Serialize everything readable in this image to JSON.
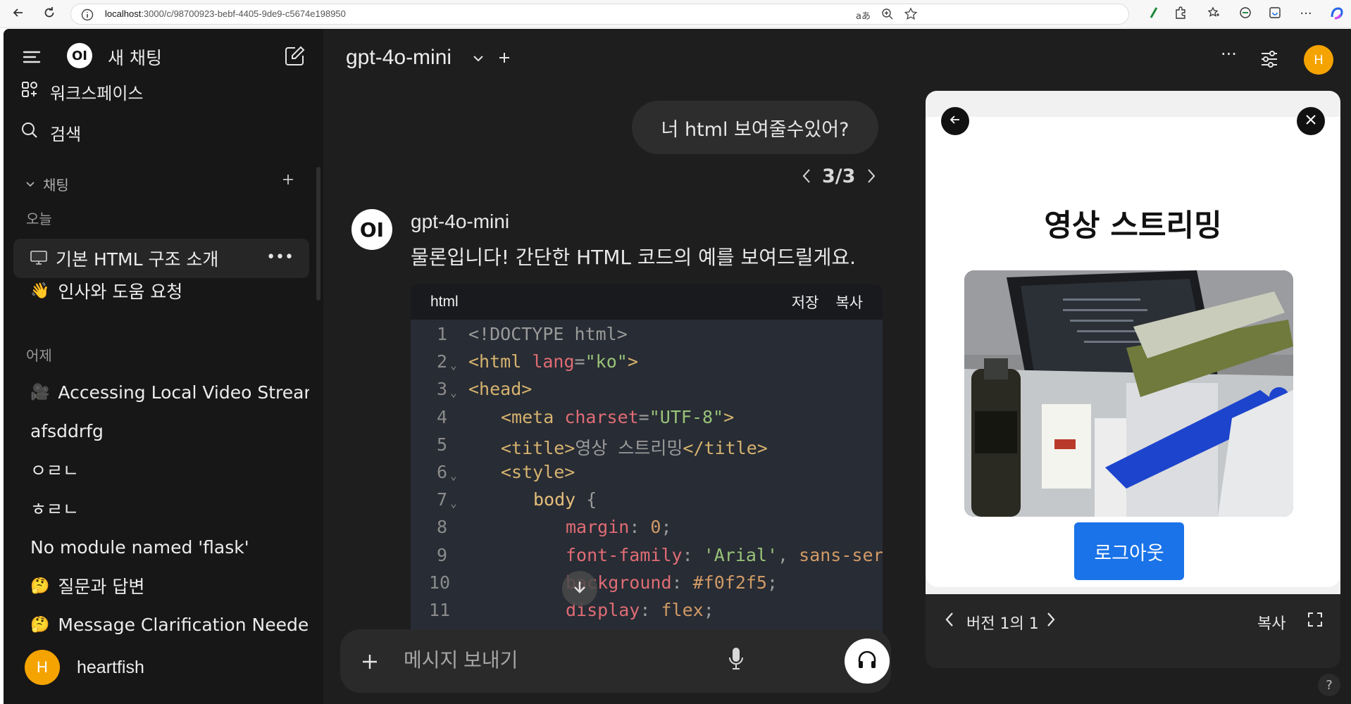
{
  "browser": {
    "url_host": "localhost",
    "url_path": ":3000/c/98700923-bebf-4405-9de9-c5674e198950",
    "icons": [
      "back-icon",
      "reload-icon",
      "info-icon",
      "translate-icon",
      "zoom-icon",
      "favorite-icon",
      "extension-icon",
      "puzzle-icon",
      "collections-icon",
      "shield-icon",
      "browser-essentials-icon",
      "more-icon",
      "copilot-icon"
    ]
  },
  "sidebar": {
    "new_chat": "새 채팅",
    "workspace": "워크스페이스",
    "search": "검색",
    "chats_section": "채팅",
    "today": "오늘",
    "yesterday": "어제",
    "today_items": [
      {
        "emoji": "💻",
        "label": "기본 HTML 구조 소개"
      },
      {
        "emoji": "👋",
        "label": "인사와 도움 요청"
      }
    ],
    "yesterday_items": [
      {
        "emoji": "🎥",
        "label": "Accessing Local Video Strear"
      },
      {
        "emoji": "",
        "label": "afsddrfg"
      },
      {
        "emoji": "",
        "label": "ㅇㄹㄴ"
      },
      {
        "emoji": "",
        "label": "ㅎㄹㄴ"
      },
      {
        "emoji": "",
        "label": "No module named 'flask'"
      },
      {
        "emoji": "🤔",
        "label": "질문과 답변"
      },
      {
        "emoji": "🤔",
        "label": "Message Clarification Neede"
      }
    ],
    "user_initial": "H",
    "user_name": "heartfish"
  },
  "header": {
    "model": "gpt-4o-mini",
    "user_initial": "H"
  },
  "chat": {
    "user_message": "너 html 보여줄수있어?",
    "pager": "3/3",
    "bot_logo": "OI",
    "bot_name": "gpt-4o-mini",
    "bot_text": "물론입니다! 간단한 HTML 코드의 예를 보여드릴게요.",
    "code_lang": "html",
    "code_save": "저장",
    "code_copy": "복사"
  },
  "code_lines": [
    {
      "n": "1",
      "fold": "",
      "indent": 0,
      "parts": [
        {
          "t": "<!DOCTYPE html>",
          "c": "muted"
        }
      ]
    },
    {
      "n": "2",
      "fold": "⌄",
      "indent": 0,
      "parts": [
        {
          "t": "<html ",
          "c": "tag"
        },
        {
          "t": "lang",
          "c": "attr"
        },
        {
          "t": "=",
          "c": "muted"
        },
        {
          "t": "\"ko\"",
          "c": "str"
        },
        {
          "t": ">",
          "c": "tag"
        }
      ]
    },
    {
      "n": "3",
      "fold": "⌄",
      "indent": 0,
      "parts": [
        {
          "t": "<head>",
          "c": "tag"
        }
      ]
    },
    {
      "n": "4",
      "fold": "",
      "indent": 1,
      "parts": [
        {
          "t": "<meta ",
          "c": "tag"
        },
        {
          "t": "charset",
          "c": "attr"
        },
        {
          "t": "=",
          "c": "muted"
        },
        {
          "t": "\"UTF-8\"",
          "c": "str"
        },
        {
          "t": ">",
          "c": "tag"
        }
      ]
    },
    {
      "n": "5",
      "fold": "",
      "indent": 1,
      "parts": [
        {
          "t": "<title>",
          "c": "tag"
        },
        {
          "t": "영상 스트리밍",
          "c": "muted"
        },
        {
          "t": "</title>",
          "c": "tag"
        }
      ]
    },
    {
      "n": "6",
      "fold": "⌄",
      "indent": 1,
      "parts": [
        {
          "t": "<style>",
          "c": "tag"
        }
      ]
    },
    {
      "n": "7",
      "fold": "⌄",
      "indent": 2,
      "parts": [
        {
          "t": "body ",
          "c": "sel"
        },
        {
          "t": "{",
          "c": "muted"
        }
      ]
    },
    {
      "n": "8",
      "fold": "",
      "indent": 3,
      "parts": [
        {
          "t": "margin",
          "c": "prop"
        },
        {
          "t": ": ",
          "c": "muted"
        },
        {
          "t": "0",
          "c": "val"
        },
        {
          "t": ";",
          "c": "muted"
        }
      ]
    },
    {
      "n": "9",
      "fold": "",
      "indent": 3,
      "parts": [
        {
          "t": "font-family",
          "c": "prop"
        },
        {
          "t": ": ",
          "c": "muted"
        },
        {
          "t": "'Arial'",
          "c": "str"
        },
        {
          "t": ", ",
          "c": "muted"
        },
        {
          "t": "sans-ser",
          "c": "val"
        }
      ]
    },
    {
      "n": "10",
      "fold": "",
      "indent": 3,
      "parts": [
        {
          "t": "background",
          "c": "prop"
        },
        {
          "t": ": ",
          "c": "muted"
        },
        {
          "t": "#f0f2f5",
          "c": "val"
        },
        {
          "t": ";",
          "c": "muted"
        }
      ]
    },
    {
      "n": "11",
      "fold": "",
      "indent": 3,
      "parts": [
        {
          "t": "display",
          "c": "prop"
        },
        {
          "t": ": ",
          "c": "muted"
        },
        {
          "t": "flex",
          "c": "val"
        },
        {
          "t": ";",
          "c": "muted"
        }
      ]
    }
  ],
  "composer": {
    "placeholder": "메시지 보내기"
  },
  "preview": {
    "title": "영상 스트리밍",
    "logout": "로그아웃",
    "version": "버전 1의 1",
    "copy": "복사"
  },
  "colors": {
    "accent": "#f5a300",
    "button_blue": "#1a73e8"
  }
}
